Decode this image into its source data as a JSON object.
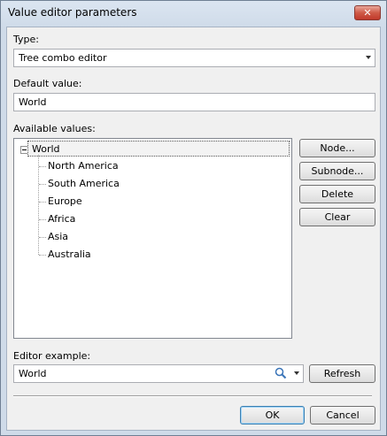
{
  "window": {
    "title": "Value editor parameters",
    "close_glyph": "✕"
  },
  "type_field": {
    "label": "Type:",
    "value": "Tree combo editor"
  },
  "default_value": {
    "label": "Default value:",
    "value": "World"
  },
  "available_values": {
    "label": "Available values:",
    "root": "World",
    "children": [
      "North America",
      "South America",
      "Europe",
      "Africa",
      "Asia",
      "Australia"
    ]
  },
  "buttons": {
    "node": "Node...",
    "subnode": "Subnode...",
    "delete": "Delete",
    "clear": "Clear",
    "refresh": "Refresh",
    "ok": "OK",
    "cancel": "Cancel"
  },
  "editor_example": {
    "label": "Editor example:",
    "value": "World"
  },
  "icons": {
    "search": "search-icon",
    "dropdown": "chevron-down-icon",
    "collapse": "minus-box-icon"
  }
}
